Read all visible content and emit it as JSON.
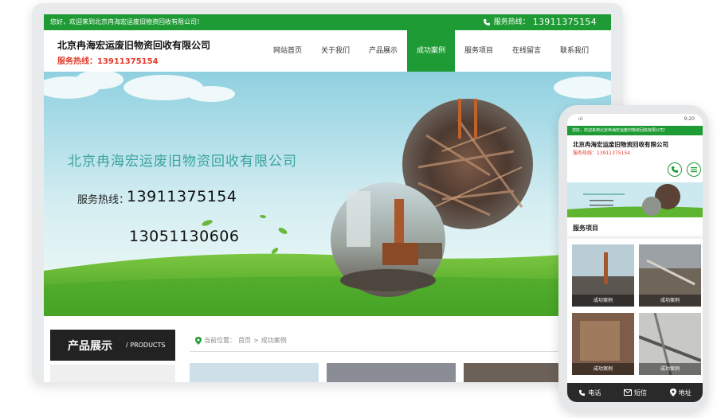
{
  "desktop": {
    "topbar": {
      "welcome": "您好，欢迎来到北京冉海宏运废旧物资回收有限公司！",
      "hotline_label": "服务热线：",
      "hotline_number": "13911375154"
    },
    "brand": {
      "name": "北京冉海宏运废旧物资回收有限公司",
      "tel": "服务热线：13911375154"
    },
    "nav": [
      "网站首页",
      "关于我们",
      "产品展示",
      "成功案例",
      "服务项目",
      "在线留言",
      "联系我们"
    ],
    "nav_active": "成功案例",
    "banner": {
      "title": "北京冉海宏运废旧物资回收有限公司",
      "hotline_label": "服务热线：",
      "phone1": "13911375154",
      "phone2": "13051130606"
    },
    "sidebar": {
      "title": "产品展示",
      "subtitle": "/ PRODUCTS"
    },
    "breadcrumb": {
      "prefix": "当前位置：",
      "home": "首页",
      "separator": ">",
      "current": "成功案例"
    }
  },
  "mobile": {
    "status_signal": "ııl",
    "status_time": "9:20",
    "topbar": "您好，欢迎来到北京冉海宏运废旧物资回收有限公司！",
    "brand_name": "北京冉海宏运废旧物资回收有限公司",
    "brand_tel": "服务热线：13911375154",
    "section_title": "服务项目",
    "cards": [
      "成功案例",
      "成功案例",
      "成功案例",
      "成功案例"
    ],
    "footer": [
      "电话",
      "短信",
      "地址"
    ]
  },
  "colors": {
    "brand_green": "#1f9b35",
    "accent_red": "#e53b2c",
    "banner_title_teal": "#39a3a0"
  }
}
